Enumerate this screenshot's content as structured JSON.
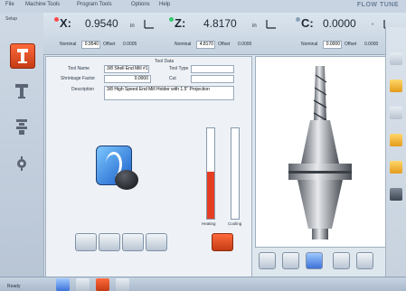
{
  "menubar": {
    "items": [
      "File",
      "Machine Tools",
      "Program Tools",
      "Options",
      "Help"
    ],
    "brand": "FLOW TUNE"
  },
  "leftbar": {
    "label": "Setup"
  },
  "axes": [
    {
      "letter": "X:",
      "value": "0.9540",
      "unit": "in",
      "dot": "#ff4a4a",
      "nominal_label": "Nominal",
      "nominal_value": "0.9540",
      "offset_label": "Offset",
      "offset_value": "0.0005"
    },
    {
      "letter": "Z:",
      "value": "4.8170",
      "unit": "in",
      "dot": "#36c86b",
      "nominal_label": "Nominal",
      "nominal_value": "4.8170",
      "offset_label": "Offset",
      "offset_value": "0.0000"
    },
    {
      "letter": "C:",
      "value": "0.0000",
      "unit": "°",
      "dot": "#8aa0b8",
      "nominal_label": "Nominal",
      "nominal_value": "0.0000",
      "offset_label": "Offset",
      "offset_value": "0.0000"
    }
  ],
  "panel": {
    "header": "Tool Data",
    "fields": {
      "tool_name_label": "Tool Name",
      "tool_name_value": "3/8 Shell End Mill #1",
      "tool_type_label": "Tool Type",
      "tool_type_value": "",
      "shrinkage_label": "Shrinkage Factor",
      "shrinkage_value": "0.0000",
      "cut_label": "Cut",
      "cut_value": "",
      "description_label": "Description",
      "description_value": "3/8 High Speed End Mill Holder with 1.5\" Projection"
    }
  },
  "gauges": {
    "left_label": "Heating",
    "right_label": "Cooling",
    "left_fill": 0.52,
    "right_fill": 0.0,
    "fill_color": "#e53d24"
  },
  "status": "Ready"
}
